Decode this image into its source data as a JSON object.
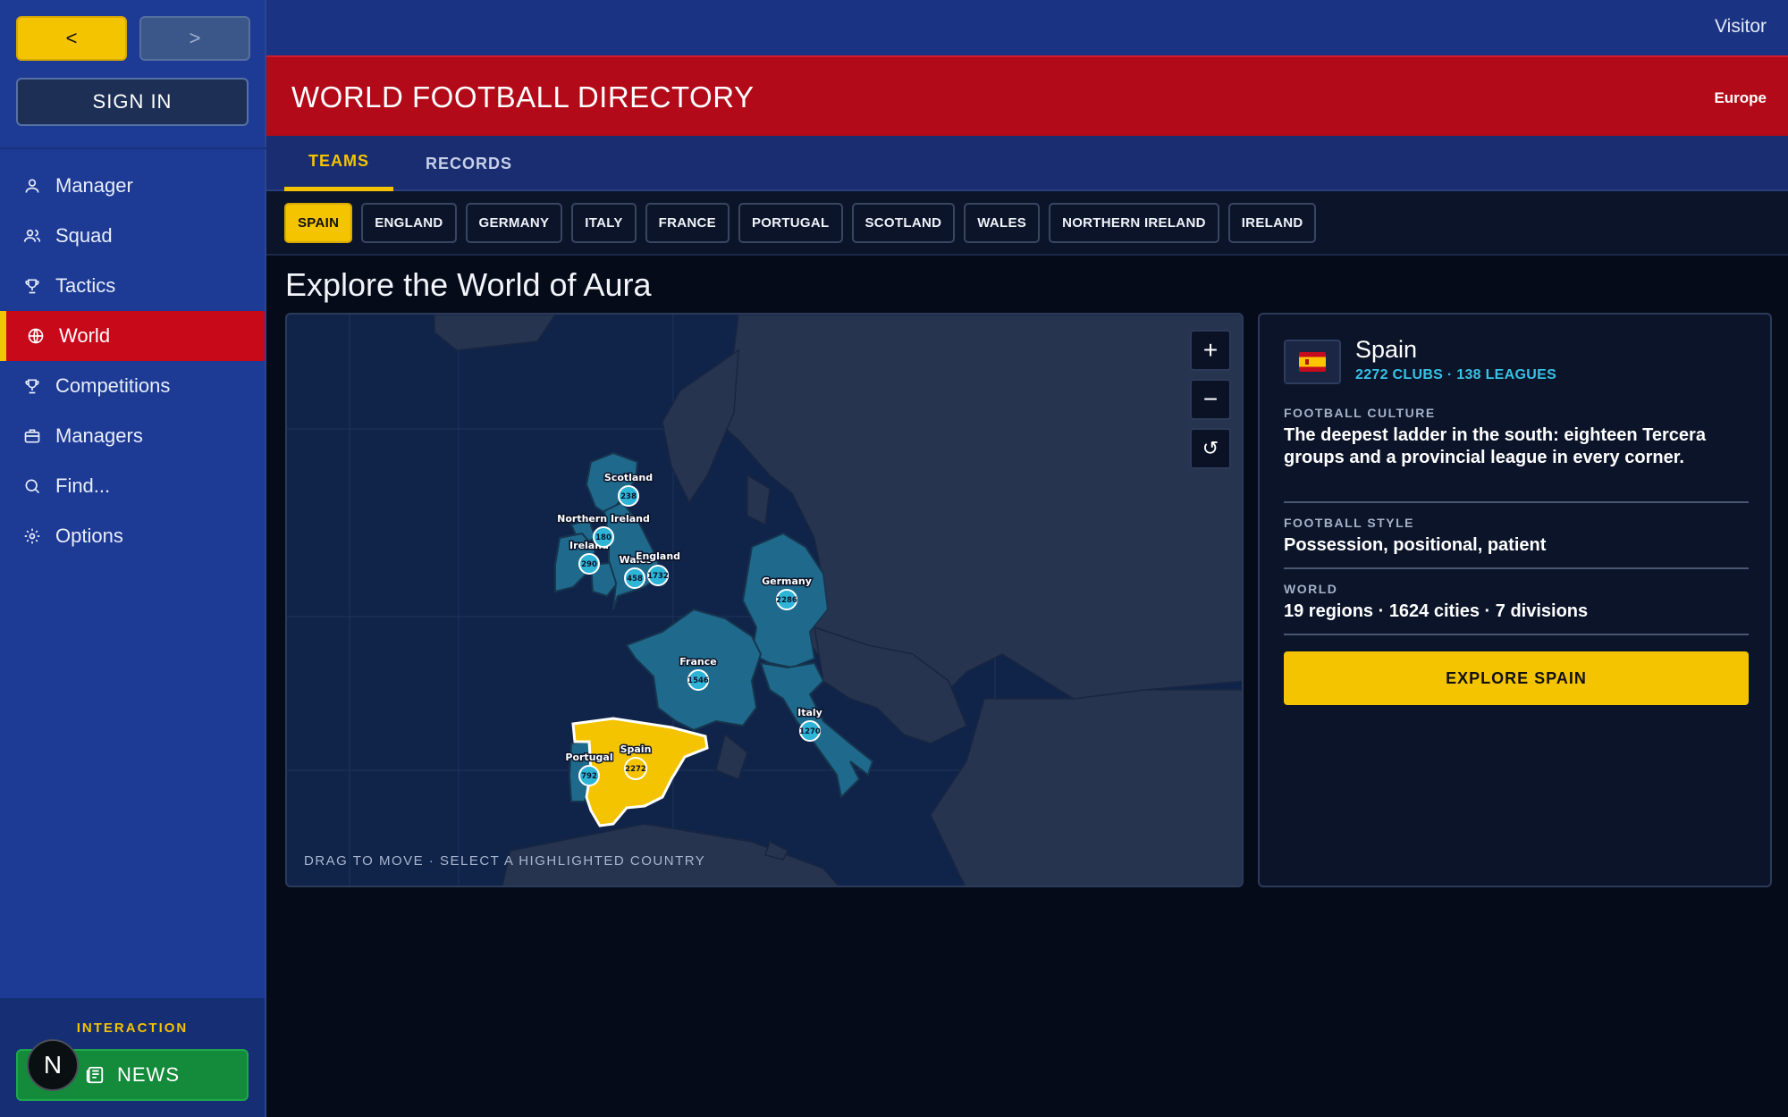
{
  "nav": {
    "back_label": "<",
    "forward_label": ">"
  },
  "auth": {
    "signin_label": "SIGN IN",
    "user_label": "Visitor"
  },
  "sidebar": {
    "items": [
      {
        "label": "Manager",
        "icon": "person-icon"
      },
      {
        "label": "Squad",
        "icon": "people-icon"
      },
      {
        "label": "Tactics",
        "icon": "trophy-icon"
      },
      {
        "label": "World",
        "icon": "globe-icon",
        "active": true
      },
      {
        "label": "Competitions",
        "icon": "trophy-icon"
      },
      {
        "label": "Managers",
        "icon": "briefcase-icon"
      },
      {
        "label": "Find...",
        "icon": "search-icon"
      },
      {
        "label": "Options",
        "icon": "gear-icon"
      }
    ],
    "interaction_label": "INTERACTION",
    "news_label": "NEWS",
    "avatar_letter": "N"
  },
  "header": {
    "title": "WORLD FOOTBALL DIRECTORY",
    "region": "Europe"
  },
  "tabs": [
    {
      "label": "TEAMS",
      "active": true
    },
    {
      "label": "RECORDS",
      "active": false
    }
  ],
  "countries": [
    "SPAIN",
    "ENGLAND",
    "GERMANY",
    "ITALY",
    "FRANCE",
    "PORTUGAL",
    "SCOTLAND",
    "WALES",
    "NORTHERN IRELAND",
    "IRELAND"
  ],
  "selected_country": "SPAIN",
  "heading": "Explore the World of Aura",
  "map": {
    "hint": "DRAG TO MOVE · SELECT A HIGHLIGHTED COUNTRY",
    "zoom_in": "+",
    "zoom_out": "−",
    "reset": "↺",
    "markers": [
      {
        "name": "Scotland",
        "count": "238"
      },
      {
        "name": "Northern Ireland",
        "count": "180"
      },
      {
        "name": "Ireland",
        "count": "290"
      },
      {
        "name": "Wales",
        "count": "458"
      },
      {
        "name": "England",
        "count": "1732"
      },
      {
        "name": "Germany",
        "count": "2286"
      },
      {
        "name": "France",
        "count": "1546"
      },
      {
        "name": "Italy",
        "count": "1270"
      },
      {
        "name": "Portugal",
        "count": "792"
      },
      {
        "name": "Spain",
        "count": "2272"
      }
    ],
    "colors": {
      "sea": "#10244a",
      "land": "#243352",
      "playable": "#1f6a8c",
      "selected": "#f5c400",
      "marker": "#2db4d6"
    }
  },
  "detail": {
    "flag_icon": "spain-flag-icon",
    "name": "Spain",
    "stats": "2272 CLUBS · 138 LEAGUES",
    "culture_label": "FOOTBALL CULTURE",
    "culture_text": "The deepest ladder in the south: eighteen Tercera groups and a provincial league in every corner.",
    "style_label": "FOOTBALL STYLE",
    "style_text": "Possession, positional, patient",
    "world_label": "WORLD",
    "world_text": "19 regions · 1624 cities · 7 divisions",
    "explore_label": "EXPLORE SPAIN"
  },
  "colors": {
    "accent": "#f5c400",
    "brand_red": "#b20a18",
    "sidebar_blue": "#1d3a94",
    "news_green": "#148a3b"
  }
}
